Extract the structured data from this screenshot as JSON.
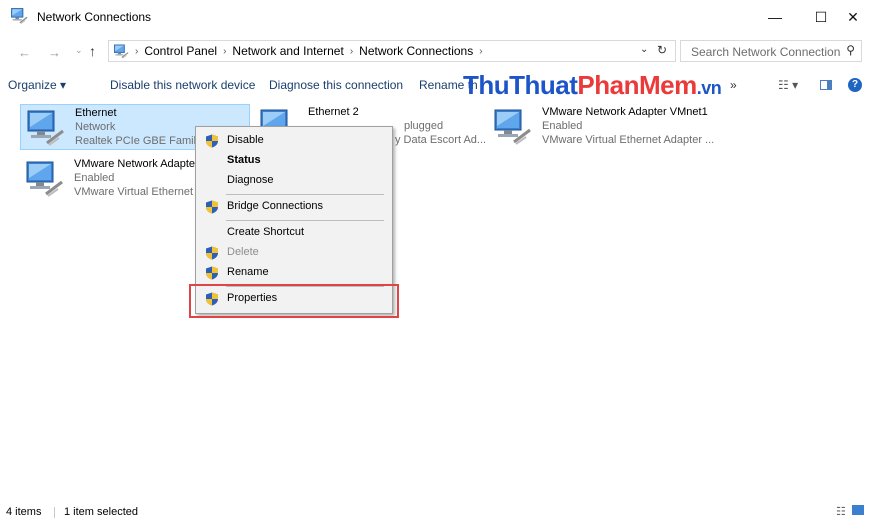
{
  "window": {
    "title": "Network Connections",
    "minimize": "—",
    "maximize": "☐",
    "close": "✕"
  },
  "address": {
    "crumbs": [
      "Control Panel",
      "Network and Internet",
      "Network Connections"
    ],
    "search_placeholder": "Search Network Connections"
  },
  "toolbar": {
    "organize": "Organize ▾",
    "disable": "Disable this network device",
    "diagnose": "Diagnose this connection",
    "rename": "Rename th",
    "more": "»"
  },
  "watermark": {
    "part1": "Thu",
    "part2": "Thuat",
    "part3": "PhanMem",
    "part4": ".vn"
  },
  "items": [
    {
      "name": "Ethernet",
      "status": "Network",
      "device": "Realtek PCIe GBE Family"
    },
    {
      "name": "Ethernet 2",
      "status": "plugged",
      "device": "y Data Escort Ad..."
    },
    {
      "name": "VMware Network Adapter VMnet1",
      "status": "Enabled",
      "device": "VMware Virtual Ethernet Adapter ..."
    },
    {
      "name": "VMware Network Adapte",
      "status": "Enabled",
      "device": "VMware Virtual Ethernet"
    }
  ],
  "context_menu": {
    "disable": "Disable",
    "status": "Status",
    "diagnose": "Diagnose",
    "bridge": "Bridge Connections",
    "shortcut": "Create Shortcut",
    "delete": "Delete",
    "rename": "Rename",
    "properties": "Properties"
  },
  "statusbar": {
    "count": "4 items",
    "selected": "1 item selected"
  },
  "colors": {
    "selection": "#cce8ff",
    "highlight_box": "#e04545",
    "watermark_blue": "#1d55c8",
    "watermark_red": "#ea3a3a"
  }
}
